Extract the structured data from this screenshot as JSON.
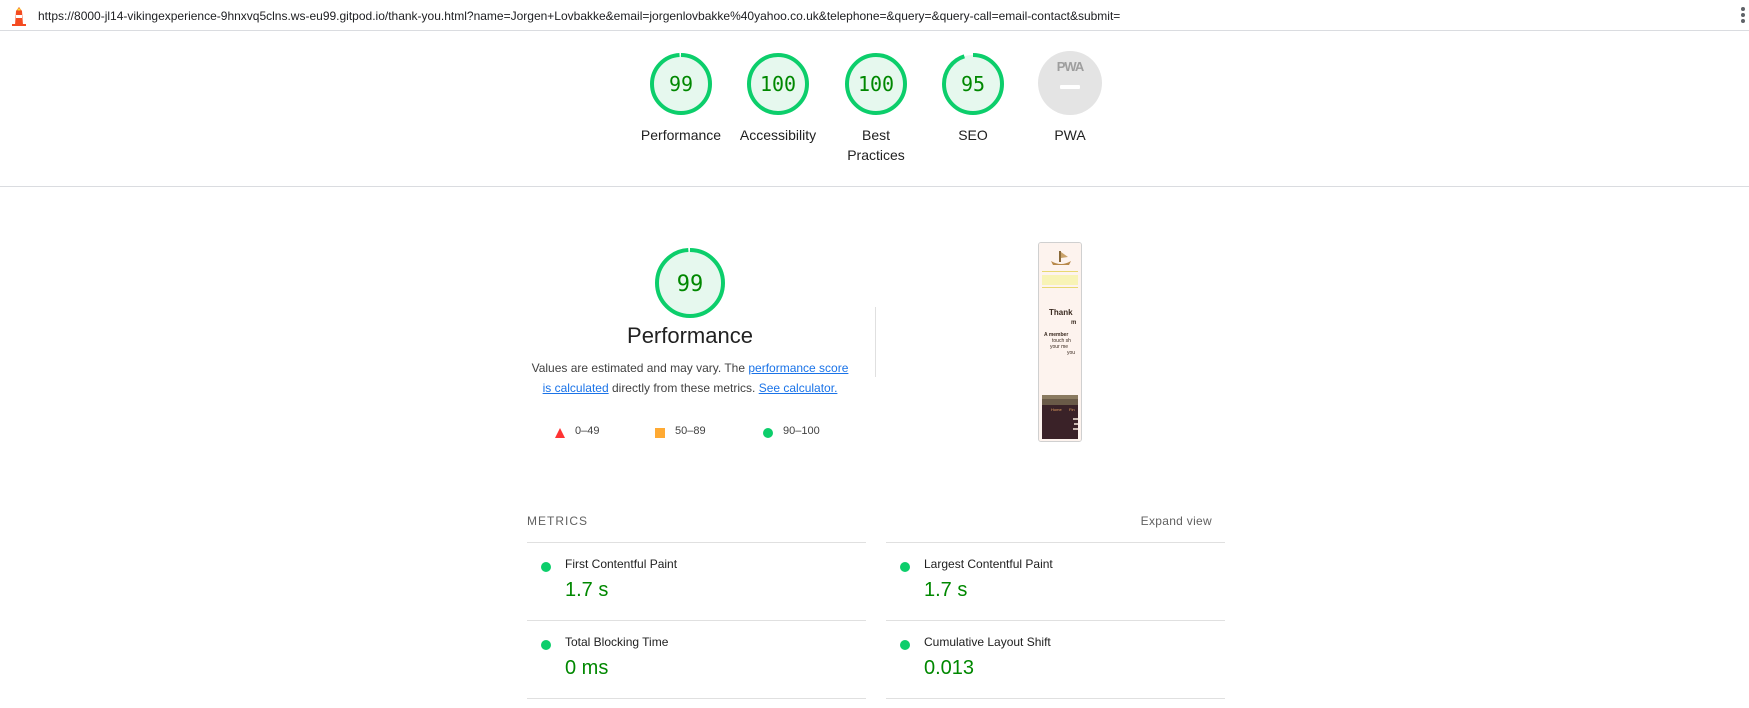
{
  "address_bar": {
    "url": "https://8000-jl14-vikingexperience-9hnxvq5clns.ws-eu99.gitpod.io/thank-you.html?name=Jorgen+Lovbakke&email=jorgenlovbakke%40yahoo.co.uk&telephone=&query=&query-call=email-contact&submit="
  },
  "score_summary": [
    {
      "score": "99",
      "label": "Performance",
      "fraction": 0.99
    },
    {
      "score": "100",
      "label": "Accessibility",
      "fraction": 1.0
    },
    {
      "score": "100",
      "label_line1": "Best",
      "label_line2": "Practices",
      "fraction": 1.0
    },
    {
      "score": "95",
      "label": "SEO",
      "fraction": 0.95
    },
    {
      "badge_text": "PWA",
      "label": "PWA"
    }
  ],
  "performance": {
    "score": "99",
    "fraction": 0.99,
    "title": "Performance",
    "desc_prefix": "Values are estimated and may vary. The ",
    "desc_link1": "performance score is calculated",
    "desc_middle": " directly from these metrics. ",
    "desc_link2": "See calculator.",
    "legend": [
      {
        "range": "0–49",
        "shape": "triangle",
        "color": "#ff3333"
      },
      {
        "range": "50–89",
        "shape": "square",
        "color": "#ffaa33"
      },
      {
        "range": "90–100",
        "shape": "circle",
        "color": "#0cce6b"
      }
    ]
  },
  "screenshot_preview": {
    "lines": [
      "Thank",
      "m",
      "A member",
      "touch sh",
      "your me",
      "you"
    ],
    "footer_lines": [
      "Home",
      "Fin"
    ]
  },
  "metrics": {
    "title": "METRICS",
    "expand_label": "Expand view",
    "items": [
      {
        "name": "First Contentful Paint",
        "value": "1.7 s"
      },
      {
        "name": "Largest Contentful Paint",
        "value": "1.7 s"
      },
      {
        "name": "Total Blocking Time",
        "value": "0 ms"
      },
      {
        "name": "Cumulative Layout Shift",
        "value": "0.013"
      }
    ]
  },
  "colors": {
    "pass_green": "#0cce6b",
    "pass_text": "#008800",
    "pass_fill": "#e6f8ee",
    "average": "#ffaa33",
    "fail": "#ff3333",
    "link": "#1a73e8"
  }
}
